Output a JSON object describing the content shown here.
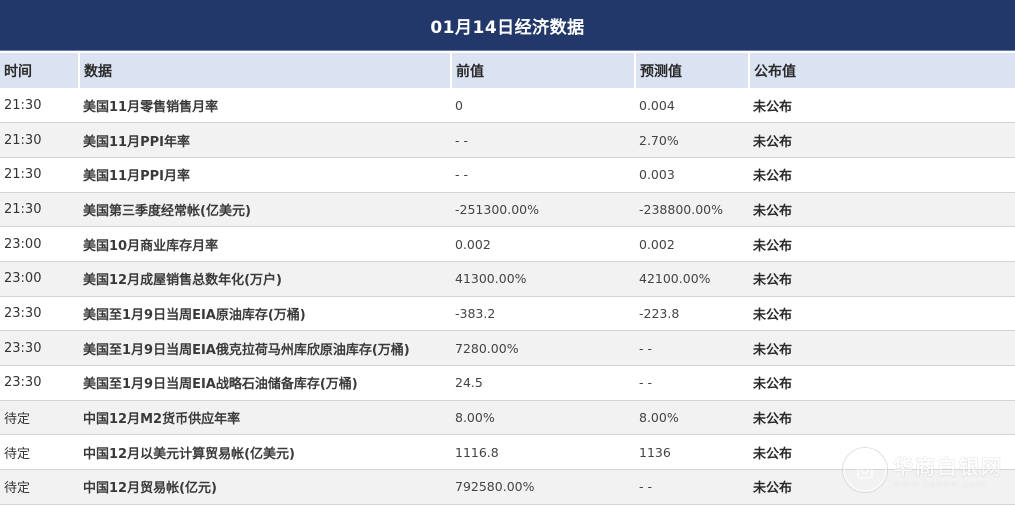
{
  "title": "01月14日经济数据",
  "columns": {
    "time": "时间",
    "name": "数据",
    "previous": "前值",
    "forecast": "预测值",
    "published": "公布值"
  },
  "rows": [
    {
      "time": "21:30",
      "name": "美国11月零售销售月率",
      "previous": "0",
      "forecast": "0.004",
      "published": "未公布"
    },
    {
      "time": "21:30",
      "name": "美国11月PPI年率",
      "previous": "- -",
      "forecast": "2.70%",
      "published": "未公布"
    },
    {
      "time": "21:30",
      "name": "美国11月PPI月率",
      "previous": "- -",
      "forecast": "0.003",
      "published": "未公布"
    },
    {
      "time": "21:30",
      "name": "美国第三季度经常帐(亿美元)",
      "previous": "-251300.00%",
      "forecast": "-238800.00%",
      "published": "未公布"
    },
    {
      "time": "23:00",
      "name": "美国10月商业库存月率",
      "previous": "0.002",
      "forecast": "0.002",
      "published": "未公布"
    },
    {
      "time": "23:00",
      "name": "美国12月成屋销售总数年化(万户)",
      "previous": "41300.00%",
      "forecast": "42100.00%",
      "published": "未公布"
    },
    {
      "time": "23:30",
      "name": "美国至1月9日当周EIA原油库存(万桶)",
      "previous": "-383.2",
      "forecast": "-223.8",
      "published": "未公布"
    },
    {
      "time": "23:30",
      "name": "美国至1月9日当周EIA俄克拉荷马州库欣原油库存(万桶)",
      "previous": "7280.00%",
      "forecast": "- -",
      "published": "未公布"
    },
    {
      "time": "23:30",
      "name": "美国至1月9日当周EIA战略石油储备库存(万桶)",
      "previous": "24.5",
      "forecast": "- -",
      "published": "未公布"
    },
    {
      "time": "待定",
      "name": "中国12月M2货币供应年率",
      "previous": "8.00%",
      "forecast": "8.00%",
      "published": "未公布"
    },
    {
      "time": "待定",
      "name": "中国12月以美元计算贸易帐(亿美元)",
      "previous": "1116.8",
      "forecast": "1136",
      "published": "未公布"
    },
    {
      "time": "待定",
      "name": "中国12月贸易帐(亿元)",
      "previous": "792580.00%",
      "forecast": "- -",
      "published": "未公布"
    }
  ],
  "watermark": {
    "name": "华商白银网",
    "url": "www.hsbyw.com",
    "icon": "logo-icon"
  },
  "colors": {
    "header_bg": "#22386a",
    "column_header_bg": "#dbe3f3",
    "stripe_bg": "#f2f2f2"
  }
}
